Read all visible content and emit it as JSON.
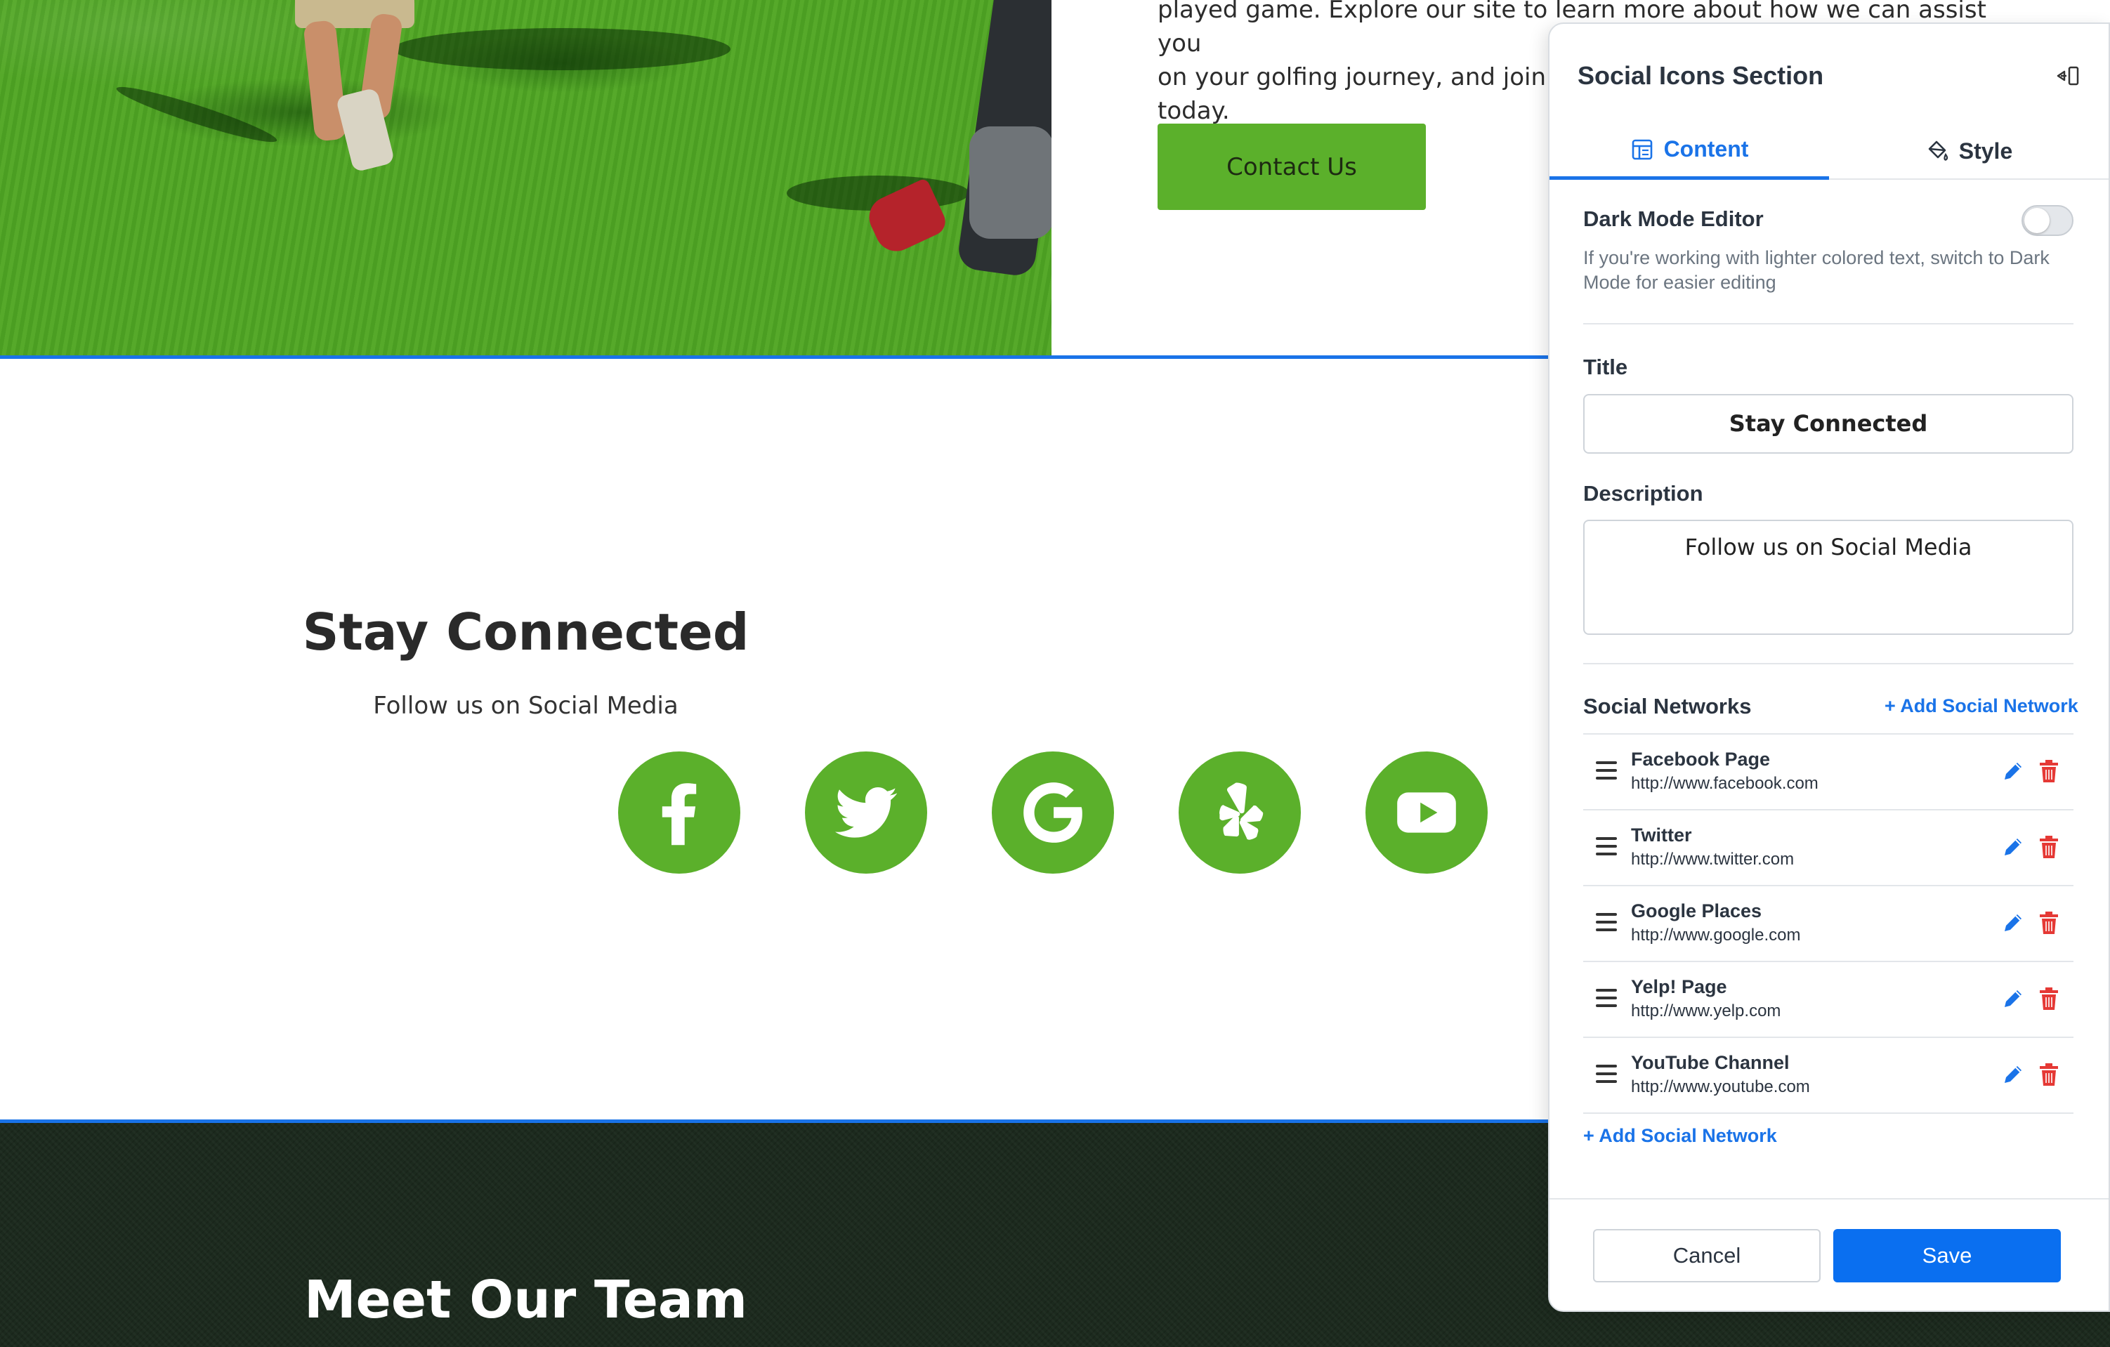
{
  "hero": {
    "text": "played game. Explore our site to learn more about how we can assist you on your golfing journey, and join the community of golf enthusiasts today.",
    "text_visible_line1": "played game. Explore our site to learn more about how we can assist you",
    "text_visible_line2": "on your golfing journey, and join tl",
    "text_visible_line3": "today.",
    "contact_button": "Contact Us"
  },
  "social_section": {
    "title": "Stay Connected",
    "description": "Follow us on Social Media",
    "icons": [
      "facebook-icon",
      "twitter-icon",
      "google-icon",
      "yelp-icon",
      "youtube-icon"
    ],
    "accent_color": "#5bb02b"
  },
  "team_section": {
    "title": "Meet Our Team"
  },
  "panel": {
    "title": "Social Icons Section",
    "tabs": [
      {
        "label": "Content",
        "active": true
      },
      {
        "label": "Style",
        "active": false
      }
    ],
    "dark_mode": {
      "label": "Dark Mode Editor",
      "enabled": false,
      "help": "If you're working with lighter colored text, switch to Dark Mode for easier editing"
    },
    "title_field": {
      "label": "Title",
      "value": "Stay Connected"
    },
    "description_field": {
      "label": "Description",
      "value": "Follow us on Social Media"
    },
    "networks": {
      "label": "Social Networks",
      "add_label": "+ Add Social Network",
      "items": [
        {
          "name": "Facebook Page",
          "url": "http://www.facebook.com"
        },
        {
          "name": "Twitter",
          "url": "http://www.twitter.com"
        },
        {
          "name": "Google Places",
          "url": "http://www.google.com"
        },
        {
          "name": "Yelp! Page",
          "url": "http://www.yelp.com"
        },
        {
          "name": "YouTube Channel",
          "url": "http://www.youtube.com"
        }
      ]
    },
    "cancel_label": "Cancel",
    "save_label": "Save",
    "accent_color": "#1a73e8",
    "delete_color": "#e53935"
  }
}
